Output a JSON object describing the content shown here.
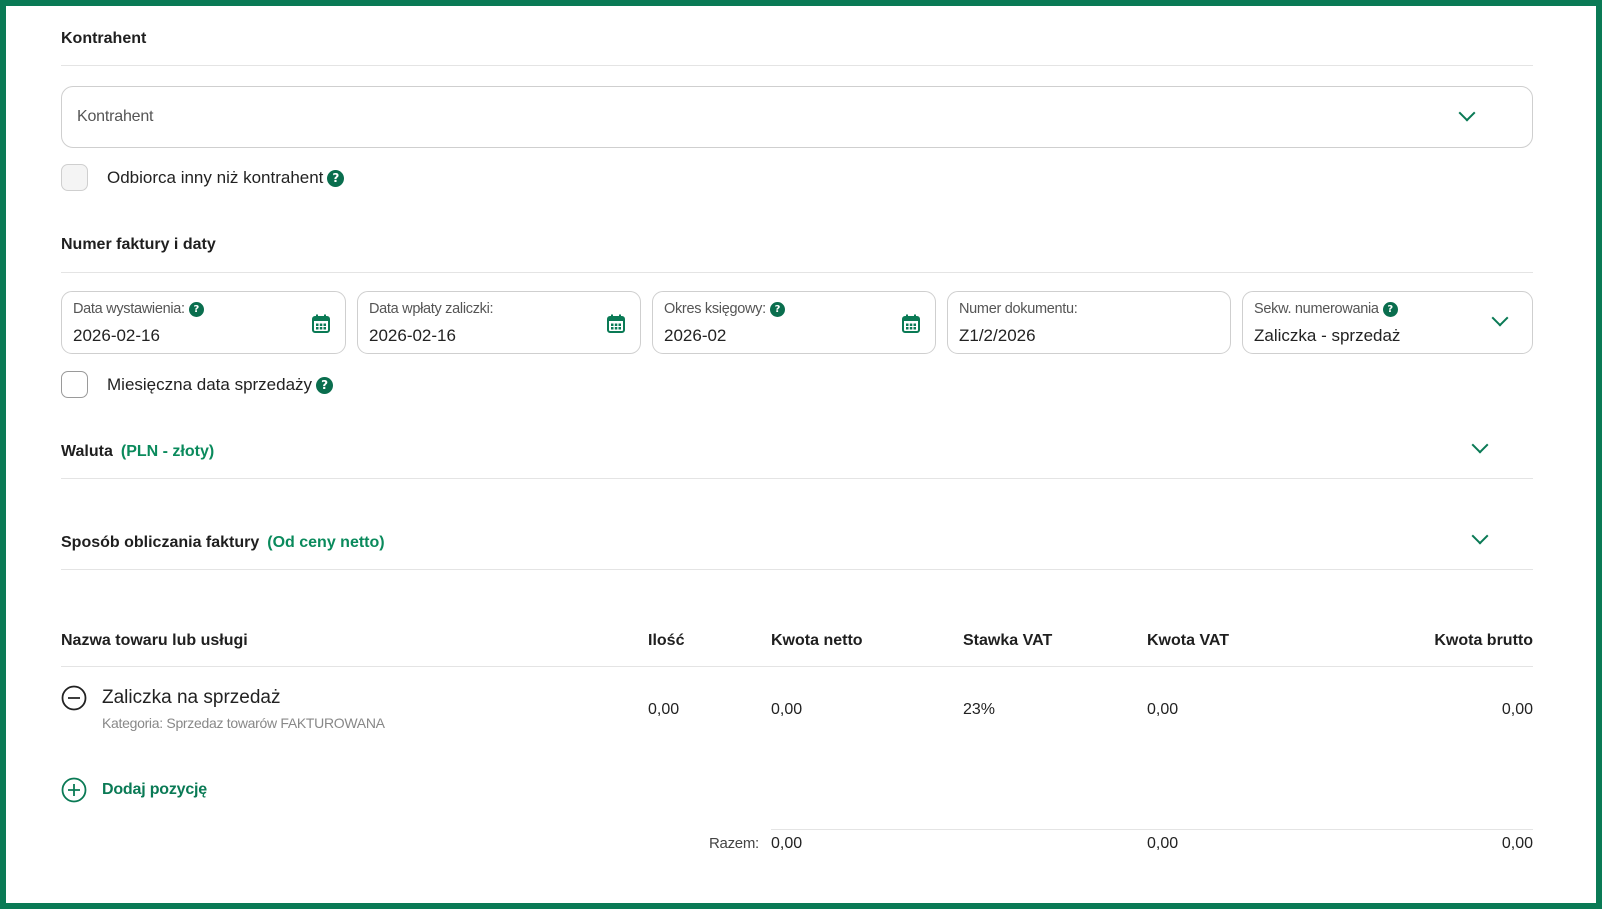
{
  "contractor": {
    "section_title": "Kontrahent",
    "select_placeholder": "Kontrahent",
    "other_recipient_label": "Odbiorca inny niż kontrahent"
  },
  "dates": {
    "section_title": "Numer faktury i daty",
    "issue_date": {
      "label": "Data wystawienia:",
      "value": "2026-02-16"
    },
    "advance_payment_date": {
      "label": "Data wpłaty zaliczki:",
      "value": "2026-02-16"
    },
    "accounting_period": {
      "label": "Okres księgowy:",
      "value": "2026-02"
    },
    "document_number": {
      "label": "Numer dokumentu:",
      "value": "Z1/2/2026"
    },
    "numbering_sequence": {
      "label": "Sekw. numerowania",
      "value": "Zaliczka - sprzedaż"
    },
    "monthly_sale_date_label": "Miesięczna data sprzedaży"
  },
  "currency": {
    "title": "Waluta",
    "value": "(PLN - złoty)"
  },
  "calculation": {
    "title": "Sposób obliczania faktury",
    "value": "(Od ceny netto)"
  },
  "table": {
    "headers": [
      "Nazwa towaru lub usługi",
      "Ilość",
      "Kwota netto",
      "Stawka VAT",
      "Kwota VAT",
      "Kwota brutto"
    ],
    "rows": [
      {
        "name": "Zaliczka na sprzedaż",
        "category": "Kategoria: Sprzedaz towarów FAKTUROWANA",
        "quantity": "0,00",
        "net": "0,00",
        "vat_rate": "23%",
        "vat": "0,00",
        "gross": "0,00"
      }
    ],
    "add_position_label": "Dodaj pozycję",
    "totals": {
      "label": "Razem:",
      "net": "0,00",
      "vat": "0,00",
      "gross": "0,00"
    }
  },
  "icons": {
    "help": "?",
    "accent_color": "#0a7a55"
  }
}
